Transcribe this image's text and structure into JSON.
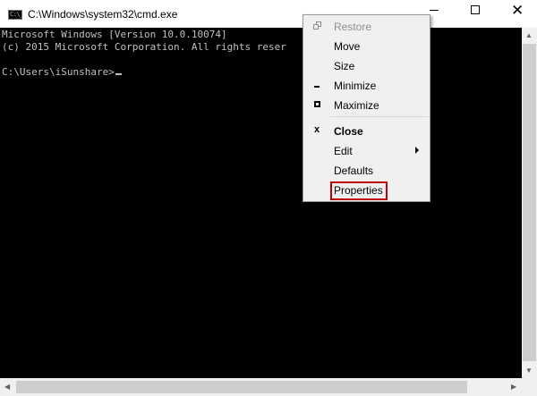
{
  "window": {
    "title": "C:\\Windows\\system32\\cmd.exe",
    "icon_text": "C:\\_"
  },
  "titlebar_buttons": {
    "minimize_icon": "minimize-icon",
    "maximize_icon": "maximize-icon",
    "close_icon": "close-icon",
    "close_glyph": "✕"
  },
  "console": {
    "line1": "Microsoft Windows [Version 10.0.10074]",
    "line2": "(c) 2015 Microsoft Corporation. All rights reser",
    "prompt": "C:\\Users\\iSunshare>",
    "background": "#000000",
    "foreground": "#c0c0c0"
  },
  "context_menu": {
    "items": [
      {
        "label": "Restore",
        "disabled": true,
        "icon": "restore-icon"
      },
      {
        "label": "Move"
      },
      {
        "label": "Size"
      },
      {
        "label": "Minimize",
        "icon": "minimize-icon"
      },
      {
        "label": "Maximize",
        "icon": "maximize-icon"
      },
      {
        "label": "Close",
        "bold": true,
        "icon": "close-icon",
        "glyph": "x"
      },
      {
        "label": "Edit",
        "submenu": true
      },
      {
        "label": "Defaults"
      },
      {
        "label": "Properties",
        "highlighted": true
      }
    ],
    "highlight_color": "#c00000"
  },
  "scrollbars": {
    "up_arrow": "▲",
    "down_arrow": "▼",
    "left_arrow": "◀",
    "right_arrow": "▶"
  }
}
